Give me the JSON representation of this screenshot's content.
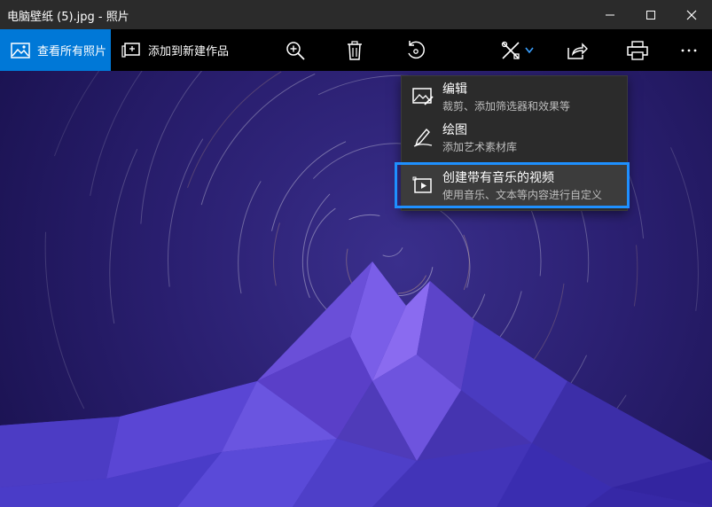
{
  "window": {
    "title": "电脑壁纸 (5).jpg - 照片"
  },
  "toolbar": {
    "view_all_label": "查看所有照片",
    "add_to_label": "添加到新建作品"
  },
  "menu": {
    "items": [
      {
        "title": "编辑",
        "subtitle": "裁剪、添加筛选器和效果等",
        "icon": "edit-photo-icon"
      },
      {
        "title": "绘图",
        "subtitle": "添加艺术素材库",
        "icon": "pen-icon"
      },
      {
        "title": "创建带有音乐的视频",
        "subtitle": "使用音乐、文本等内容进行自定义",
        "icon": "video-icon",
        "highlighted": true
      }
    ]
  },
  "colors": {
    "accent": "#0078d7",
    "highlight_border": "#1e90ff",
    "sky": "#231a63",
    "mountain": "#6a4fe0"
  }
}
